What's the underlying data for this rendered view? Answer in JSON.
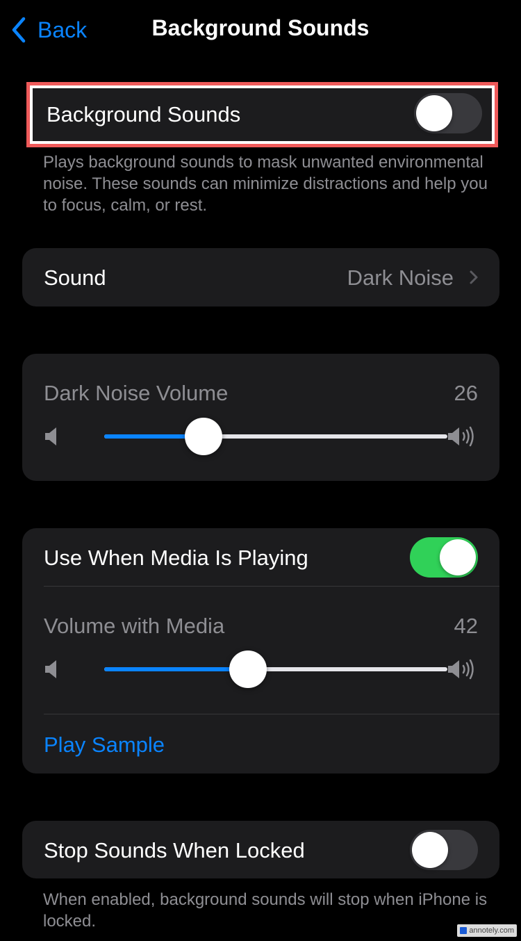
{
  "nav": {
    "back_label": "Back",
    "title": "Background Sounds"
  },
  "main_toggle": {
    "label": "Background Sounds",
    "on": false,
    "description": "Plays background sounds to mask unwanted environmental noise. These sounds can minimize distractions and help you to focus, calm, or rest."
  },
  "sound": {
    "label": "Sound",
    "value": "Dark Noise"
  },
  "volume": {
    "label": "Dark Noise Volume",
    "value": "26",
    "level": 0.29
  },
  "media": {
    "toggle_label": "Use When Media Is Playing",
    "on": true,
    "volume_label": "Volume with Media",
    "volume_value": "42",
    "level": 0.42,
    "play_sample_label": "Play Sample"
  },
  "locked": {
    "label": "Stop Sounds When Locked",
    "on": false,
    "description": "When enabled, background sounds will stop when iPhone is locked."
  },
  "colors": {
    "accent": "#0a84ff",
    "toggle_on": "#30d158",
    "highlight": "#ef5a5a"
  },
  "watermark": {
    "text": "annotely.com"
  }
}
